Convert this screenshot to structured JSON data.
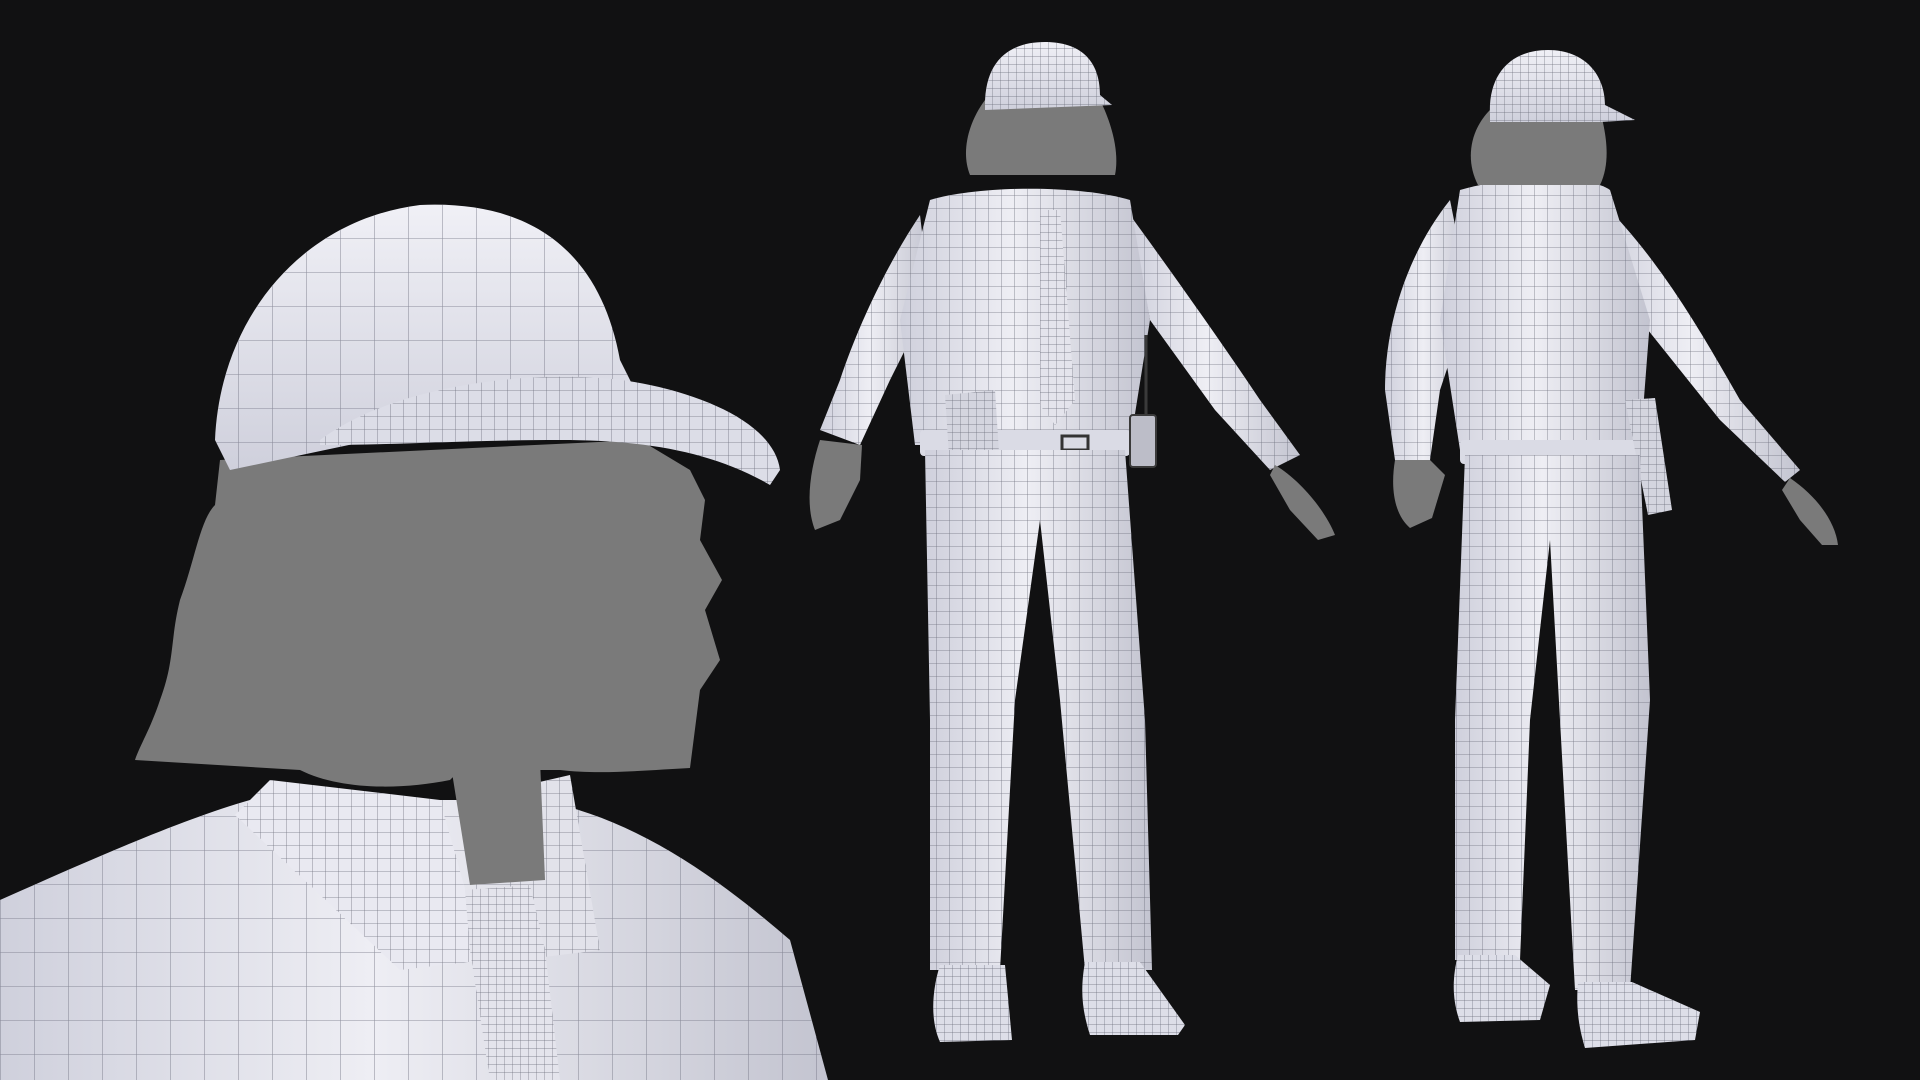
{
  "scene": {
    "description_free": true,
    "colors": {
      "background": "#111112",
      "mesh_fill": "#e6e6ee",
      "mesh_shade": "#c9cad6",
      "wire": "#70727e",
      "body_gray": "#7a7a7a",
      "accessory": "#3a3a3a"
    },
    "panels": [
      {
        "name": "close-up-view",
        "view": "head-and-collar"
      },
      {
        "name": "front-view",
        "view": "front"
      },
      {
        "name": "back-view",
        "view": "back"
      }
    ]
  }
}
